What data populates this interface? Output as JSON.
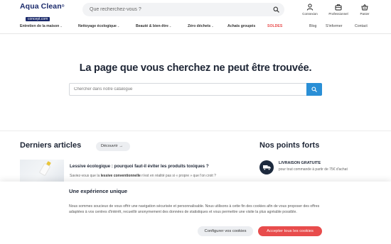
{
  "header": {
    "logo": {
      "name": "Aqua Clean",
      "tagline": "concept.com"
    },
    "search_placeholder": "Que recherchez-vous ?",
    "icons": [
      {
        "label": "Connexion",
        "icon": "user-icon"
      },
      {
        "label": "Professionnel",
        "icon": "briefcase-icon"
      },
      {
        "label": "Panier",
        "icon": "basket-icon"
      }
    ]
  },
  "nav": {
    "items": [
      "Entretien de la maison",
      "Nettoyage écologique",
      "Beauté & bien-être",
      "Zéro déchets",
      "Achats groupés",
      "SOLDES",
      "Blog",
      "S'informer",
      "Contact"
    ]
  },
  "not_found": {
    "title": "La page que vous cherchez ne peut être trouvée.",
    "search_placeholder": "Chercher dans notre catalogue"
  },
  "articles": {
    "title": "Derniers articles",
    "discover_label": "Découvrir",
    "item": {
      "title": "Lessive écologique : pourquoi faut-il éviter les produits toxiques ?",
      "excerpt_start": "Saviez-vous que la ",
      "excerpt_bold": "lessive conventionnelle",
      "excerpt_end": " n'est en réalité pas si « propre » que l'on croit ?"
    }
  },
  "strengths": {
    "title": "Nos points forts",
    "item": {
      "title": "LIVRAISON GRATUITE",
      "text": "pour tout commande à partir de 75€ d'achat",
      "icon": "truck-icon"
    }
  },
  "cookie": {
    "title": "Une expérience unique",
    "text": "Nous sommes soucieux de vous offrir une navigation sécurisée et personnalisable. Nous utilisons à cette fin des cookies afin de vous proposer des offres adaptées à vos centres d'intérêt, recueillir anonymement des données de statistiques et vous permettre une visite la plus agréable possible.",
    "configure_label": "Configurer vos cookies",
    "accept_label": "Accepter tous les cookies"
  },
  "colors": {
    "brand": "#1b2a6b",
    "accent": "#2a8fd6",
    "sale": "#e84c4c"
  }
}
